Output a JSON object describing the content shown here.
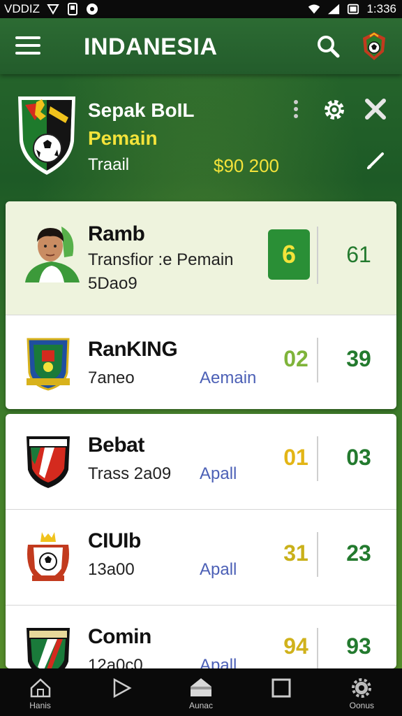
{
  "statusbar": {
    "carrier": "VDDIZ",
    "time": "1:336"
  },
  "appbar": {
    "title": "INDANESIA"
  },
  "header": {
    "team_name": "Sepak BoIL",
    "team_sub": "Pemain",
    "meta_label": "Traail",
    "value": "$90 200"
  },
  "rows": [
    {
      "title": "Ramb",
      "subtitle": "Transfior :e Pemain",
      "extra": "5Dao9",
      "link": "",
      "stat1": "6",
      "stat2": "61"
    },
    {
      "title": "RanKING",
      "subtitle": "7aneo",
      "link": "Aemain",
      "stat1": "02",
      "stat2": "39",
      "stat1_color": "#7fb43a"
    },
    {
      "title": "Bebat",
      "subtitle": "Trass    2a09",
      "link": "Apall",
      "stat1": "01",
      "stat2": "03",
      "stat1_color": "#e3b516"
    },
    {
      "title": "CIUIb",
      "subtitle": "13a00",
      "link": "Apall",
      "stat1": "31",
      "stat2": "23",
      "stat1_color": "#c9b01a"
    },
    {
      "title": "Comin",
      "subtitle": "12a0c0",
      "link": "Apall",
      "stat1": "94",
      "stat2": "93",
      "stat1_color": "#d0b21c"
    }
  ],
  "bottomnav": {
    "items": [
      {
        "label": "Hanis",
        "icon": "home-icon"
      },
      {
        "label": "",
        "icon": "play-icon"
      },
      {
        "label": "Aunac",
        "icon": "stadium-icon"
      },
      {
        "label": "",
        "icon": "square-icon"
      },
      {
        "label": "Oonus",
        "icon": "settings-icon"
      }
    ]
  }
}
